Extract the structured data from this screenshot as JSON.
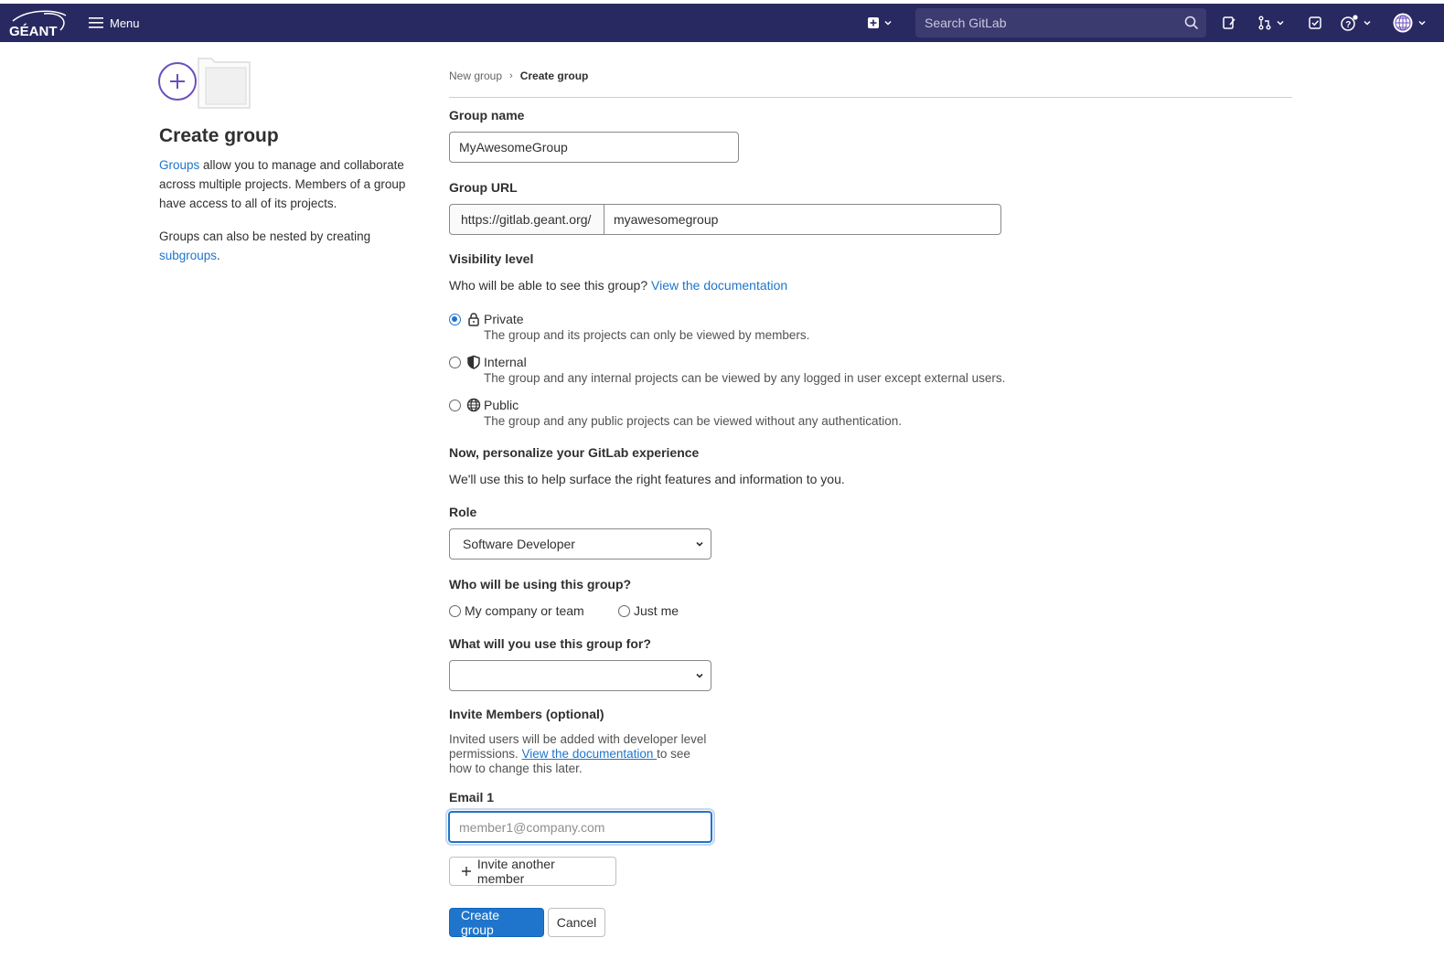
{
  "nav": {
    "logo_text": "GÉANT",
    "menu_label": "Menu",
    "search_placeholder": "Search GitLab"
  },
  "sidebar": {
    "title": "Create group",
    "description_link": "Groups",
    "description_rest": " allow you to manage and collaborate across multiple projects. Members of a group have access to all of its projects.",
    "nested_text": "Groups can also be nested by creating ",
    "nested_link": "subgroups",
    "nested_end": "."
  },
  "breadcrumb": {
    "parent": "New group",
    "separator": "›",
    "current": "Create group"
  },
  "form": {
    "group_name_label": "Group name",
    "group_name_value": "MyAwesomeGroup",
    "group_url_label": "Group URL",
    "group_url_prefix": "https://gitlab.geant.org/",
    "group_url_value": "myawesomegroup",
    "visibility_label": "Visibility level",
    "visibility_question": "Who will be able to see this group? ",
    "visibility_doc_link": "View the documentation",
    "visibility_options": [
      {
        "title": "Private",
        "help": "The group and its projects can only be viewed by members.",
        "checked": true,
        "icon": "lock-icon"
      },
      {
        "title": "Internal",
        "help": "The group and any internal projects can be viewed by any logged in user except external users.",
        "checked": false,
        "icon": "shield-icon"
      },
      {
        "title": "Public",
        "help": "The group and any public projects can be viewed without any authentication.",
        "checked": false,
        "icon": "globe-icon"
      }
    ],
    "personalize_title": "Now, personalize your GitLab experience",
    "personalize_help": "We'll use this to help surface the right features and information to you.",
    "role_label": "Role",
    "role_value": "Software Developer",
    "using_label": "Who will be using this group?",
    "using_option_1": "My company or team",
    "using_option_2": "Just me",
    "purpose_label": "What will you use this group for?",
    "purpose_value": "",
    "invite_title": "Invite Members (optional)",
    "invite_help_1": "Invited users will be added with developer level permissions. ",
    "invite_help_link": "View the documentation ",
    "invite_help_2": "to see how to change this later.",
    "email_label": "Email 1",
    "email_placeholder": "member1@company.com",
    "invite_another_label": "Invite another member",
    "create_label": "Create group",
    "cancel_label": "Cancel"
  },
  "colors": {
    "navbar": "#292961",
    "primary": "#1f75cb",
    "illustration_accent": "#6b4fbb"
  }
}
